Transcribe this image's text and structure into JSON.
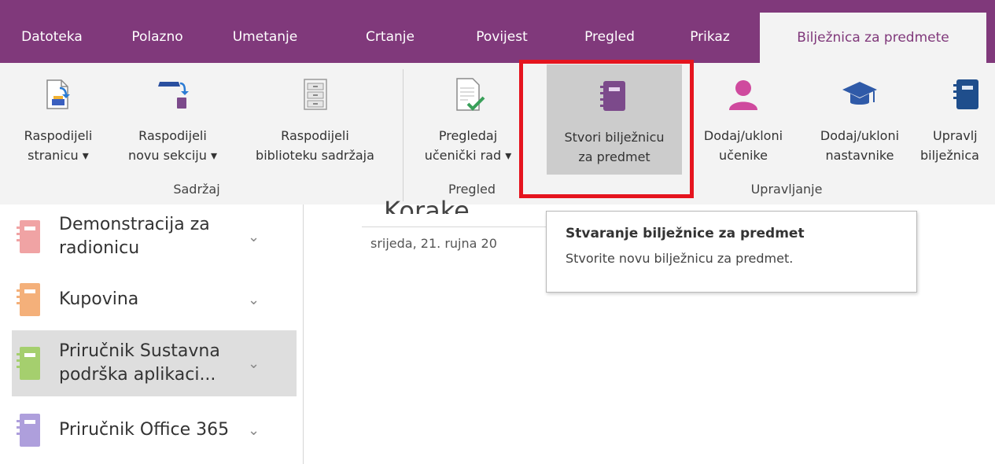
{
  "tabs": [
    {
      "label": "Datoteka"
    },
    {
      "label": "Polazno"
    },
    {
      "label": "Umetanje"
    },
    {
      "label": "Crtanje"
    },
    {
      "label": "Povijest"
    },
    {
      "label": "Pregled"
    },
    {
      "label": "Prikaz"
    },
    {
      "label": "Bilježnica za predmete",
      "active": true
    }
  ],
  "ribbon": {
    "buttons": [
      {
        "line1": "Raspodijeli",
        "line2": "stranicu ▾",
        "icon": "distribute-page-icon"
      },
      {
        "line1": "Raspodijeli",
        "line2": "novu sekciju ▾",
        "icon": "distribute-section-icon"
      },
      {
        "line1": "Raspodijeli",
        "line2": "biblioteku sadržaja",
        "icon": "content-library-icon"
      },
      {
        "line1": "Pregledaj",
        "line2": "učenički rad ▾",
        "icon": "review-work-icon"
      },
      {
        "line1": "Stvori bilježnicu",
        "line2": "za predmet",
        "icon": "create-notebook-icon",
        "selected": true
      },
      {
        "line1": "Dodaj/ukloni",
        "line2": "učenike",
        "icon": "students-icon"
      },
      {
        "line1": "Dodaj/ukloni",
        "line2": "nastavnike",
        "icon": "teachers-icon"
      },
      {
        "line1": "Upravlj",
        "line2": "bilježnica",
        "icon": "manage-notebooks-icon"
      }
    ],
    "groups": [
      {
        "label": "Sadržaj"
      },
      {
        "label": "Pregled"
      },
      {
        "label": "Upravljanje"
      }
    ],
    "colors": {
      "tabbar": "#80397b",
      "ribbon": "#f3f3f3",
      "highlight": "#e5141e"
    }
  },
  "notebooks": [
    {
      "name": "Demonstracija za radionicu",
      "color": "#f0a3a4"
    },
    {
      "name": "Kupovina",
      "color": "#f4b07a"
    },
    {
      "name": "Priručnik Sustavna podrška aplikaci...",
      "color": "#a5cf6e",
      "selected": true
    },
    {
      "name": "Priručnik Office 365",
      "color": "#ae9fdc"
    }
  ],
  "page": {
    "title": "Korake",
    "date": "srijeda, 21. rujna 20"
  },
  "tooltip": {
    "title": "Stvaranje bilježnice za predmet",
    "description": "Stvorite novu bilježnicu za predmet."
  }
}
